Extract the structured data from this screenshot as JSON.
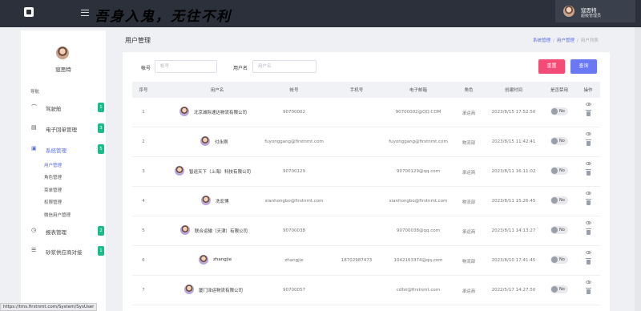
{
  "header": {
    "slogan": "吾身入鬼，无往不利",
    "user_name": "寇思特",
    "user_role": "超级管理员"
  },
  "sidebar": {
    "user_name": "寇思特",
    "nav_title": "导航",
    "menus": [
      {
        "label": "驾驶舱",
        "badge": "1",
        "icon": "dashboard-icon"
      },
      {
        "label": "电子回单管理",
        "badge": "3",
        "icon": "receipt-icon"
      },
      {
        "label": "系统管理",
        "badge": "5",
        "icon": "system-icon"
      },
      {
        "label": "报表管理",
        "badge": "2",
        "icon": "report-icon"
      },
      {
        "label": "砂浆供应商对接",
        "badge": "1",
        "icon": "list-icon"
      }
    ],
    "submenu": [
      "用户管理",
      "角色管理",
      "菜单管理",
      "权限管理",
      "微信用户管理"
    ]
  },
  "page": {
    "title": "用户管理",
    "breadcrumbs": [
      "系统管理",
      "用户管理",
      "用户列表"
    ]
  },
  "filters": {
    "account_label": "帐号",
    "account_placeholder": "帐号",
    "username_label": "用户名",
    "username_placeholder": "用户名",
    "reset_label": "重置",
    "query_label": "查询"
  },
  "table": {
    "headers": [
      "序号",
      "用户名",
      "帐号",
      "手机号",
      "电子邮箱",
      "角色",
      "创建时间",
      "是否禁用",
      "操作"
    ],
    "rows": [
      {
        "no": "1",
        "username": "北京城际速达物流有限公司",
        "account": "90700002",
        "phone": "",
        "email": "90700002@QQ.COM",
        "role": "承运商",
        "created": "2023/8/15 17:52:50",
        "disabled": "No"
      },
      {
        "no": "2",
        "username": "付永刚",
        "account": "fuyonggang@firstnmt.com",
        "phone": "",
        "email": "fuyonggang@firstnmt.com",
        "role": "物流部",
        "created": "2023/8/15 11:42:41",
        "disabled": "No"
      },
      {
        "no": "3",
        "username": "智运天下（上海）科技有限公司",
        "account": "90700129",
        "phone": "",
        "email": "90700129@qq.com",
        "role": "承运商",
        "created": "2023/8/11 16:11:02",
        "disabled": "No"
      },
      {
        "no": "4",
        "username": "冼宏博",
        "account": "xianhongbo@firstnmt.com",
        "phone": "",
        "email": "xianhongbo@firstnmt.com",
        "role": "物流部",
        "created": "2023/8/11 15:26:45",
        "disabled": "No"
      },
      {
        "no": "5",
        "username": "联合运输（天津）有限公司",
        "account": "90700038",
        "phone": "",
        "email": "90700038@qq.com",
        "role": "承运商",
        "created": "2023/8/11 14:13:27",
        "disabled": "No"
      },
      {
        "no": "6",
        "username": "zhangjie",
        "account": "zhangjie",
        "phone": "18702987473",
        "email": "1042163374@qq.com",
        "role": "物流部",
        "created": "2023/8/10 17:41:45",
        "disabled": "No"
      },
      {
        "no": "7",
        "username": "厦门泽运物流有限公司",
        "account": "90700057",
        "phone": "",
        "email": "cdfst@firstnmt.com",
        "role": "承运商",
        "created": "2022/5/17 14:27:50",
        "disabled": "No"
      }
    ]
  },
  "statusbar": {
    "url": "https://tms.firstnmt.com/System/SysUser"
  },
  "colors": {
    "accent": "#5a6ee8",
    "badge": "#1bbc8c",
    "reset": "#f34b76",
    "query": "#6a79f3",
    "topbar": "#2b303a"
  }
}
